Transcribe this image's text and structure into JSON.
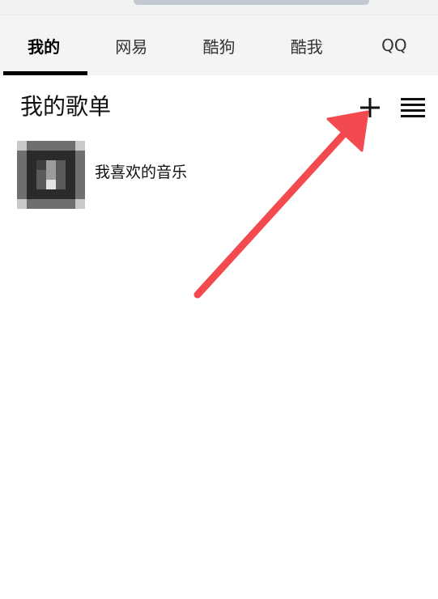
{
  "tabs": [
    {
      "label": "我的",
      "active": true
    },
    {
      "label": "网易",
      "active": false
    },
    {
      "label": "酷狗",
      "active": false
    },
    {
      "label": "酷我",
      "active": false
    },
    {
      "label": "QQ",
      "active": false
    }
  ],
  "section": {
    "title": "我的歌单",
    "add_icon": "plus-icon",
    "menu_icon": "menu-icon"
  },
  "playlists": [
    {
      "name": "我喜欢的音乐",
      "cover_icon": "music-cover"
    }
  ],
  "annotation": {
    "color": "#f24a4f",
    "icon": "arrow-annotation"
  }
}
